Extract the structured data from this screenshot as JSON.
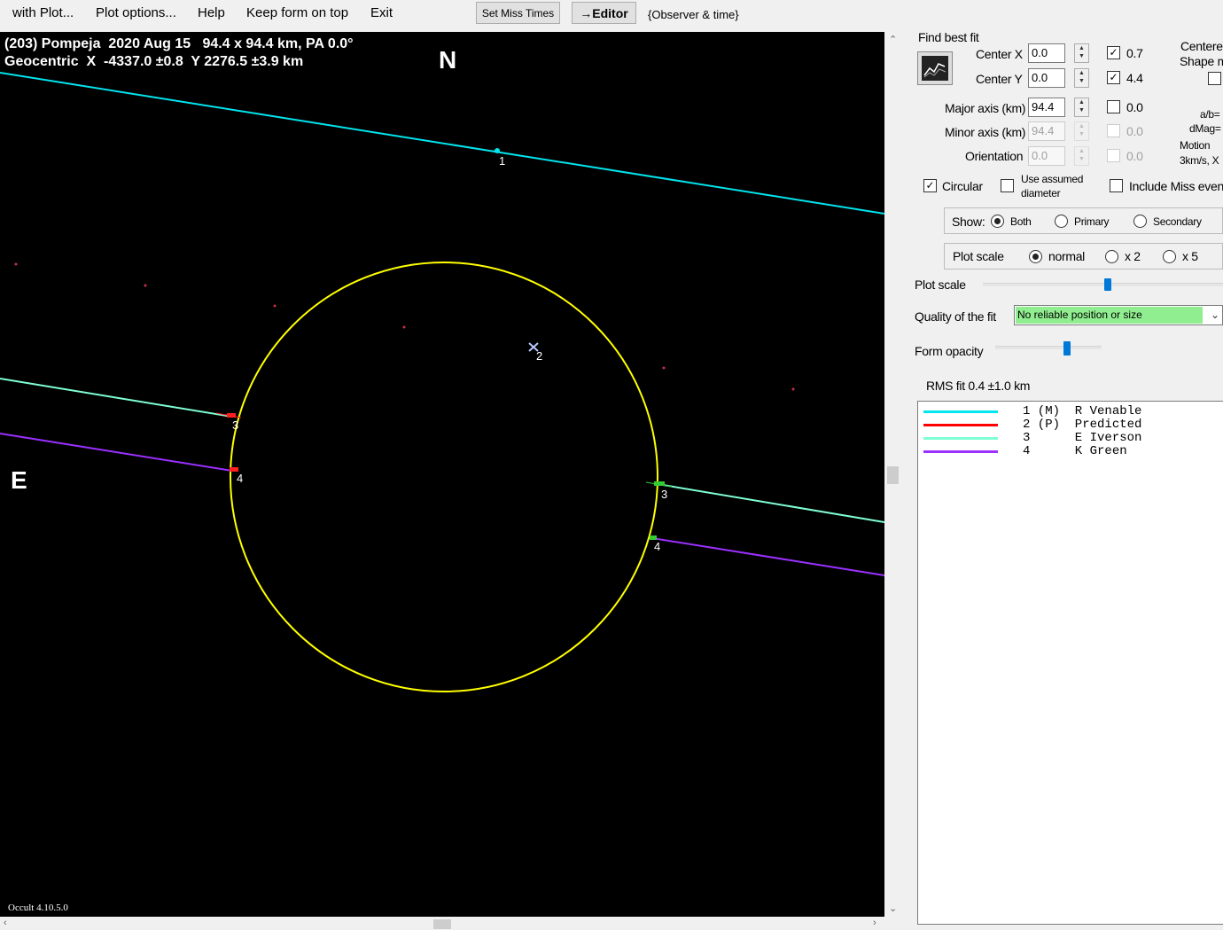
{
  "menu": {
    "with_plot": "with Plot...",
    "plot_options": "Plot options...",
    "help": "Help",
    "keep_on_top": "Keep form on top",
    "exit": "Exit",
    "set_miss_times": "Set Miss Times",
    "editor": "→Editor",
    "observer_time": "{Observer & time}"
  },
  "plot": {
    "title_line1": "(203) Pompeja  2020 Aug 15   94.4 x 94.4 km, PA 0.0°",
    "title_line2": "Geocentric  X  -4337.0 ±0.8  Y 2276.5 ±3.9 km",
    "north": "N",
    "east": "E",
    "version": "Occult 4.10.5.0",
    "chord_labels": [
      "1",
      "2",
      "3",
      "4",
      "3",
      "4"
    ],
    "colors": {
      "background": "#000000",
      "ellipse": "#ffff00",
      "chord1": "#00e5ee",
      "chord3": "#7fffd4",
      "chord4": "#9b30ff",
      "disappear_marker": "#ff2020",
      "reappear_marker": "#33cc33",
      "star_dots": "#c8304a"
    }
  },
  "panel": {
    "find_best_fit": "Find best fit",
    "center_x_label": "Center X",
    "center_x": "0.0",
    "center_y_label": "Center Y",
    "center_y": "0.0",
    "major_axis_label": "Major axis (km)",
    "major_axis": "94.4",
    "minor_axis_label": "Minor axis (km)",
    "minor_axis": "94.4",
    "orientation_label": "Orientation",
    "orientation": "0.0",
    "check_values": [
      "0.7",
      "4.4",
      "0.0",
      "0.0",
      "0.0"
    ],
    "right_labels": {
      "centered": "Centere",
      "shape": "Shape m",
      "ab": "a/b=",
      "dmag": "dMag=",
      "motion": "Motion",
      "speed": "3km/s, X"
    },
    "circular": "Circular",
    "use_assumed": "Use assumed",
    "diameter": "diameter",
    "include_miss": "Include Miss even",
    "show_label": "Show:",
    "show_both": "Both",
    "show_primary": "Primary",
    "show_secondary": "Secondary",
    "plot_scale_group": "Plot scale",
    "scale_normal": "normal",
    "scale_x2": "x 2",
    "scale_x5": "x 5",
    "plot_scale_slider_label": "Plot scale",
    "quality_label": "Quality of the fit",
    "quality_value": "No reliable position or size",
    "form_opacity_label": "Form opacity",
    "rms_fit": "RMS fit 0.4 ±1.0 km"
  },
  "legend": [
    {
      "text": "1 (M)  R Venable",
      "color": "#00e5ee"
    },
    {
      "text": "2 (P)  Predicted",
      "color": "#ff0000"
    },
    {
      "text": "3      E Iverson",
      "color": "#7fffd4"
    },
    {
      "text": "4      K Green",
      "color": "#9b30ff"
    }
  ]
}
